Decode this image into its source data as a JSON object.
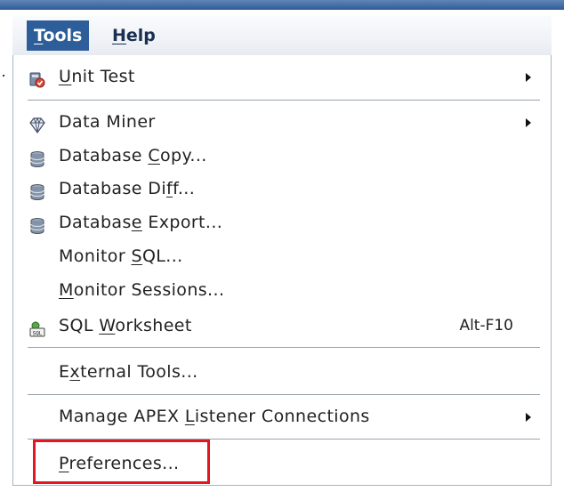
{
  "menubar": {
    "items": [
      {
        "pre": "",
        "key": "T",
        "post": "ools",
        "active": true
      },
      {
        "pre": "",
        "key": "H",
        "post": "elp",
        "active": false
      }
    ]
  },
  "menu": {
    "items": [
      {
        "pre": "",
        "key": "U",
        "post": "nit Test",
        "icon": "unit-test-icon",
        "submenu": true
      },
      {
        "pre": "Data Miner",
        "key": "",
        "post": "",
        "icon": "data-miner-icon",
        "submenu": true
      },
      {
        "pre": "Database ",
        "key": "C",
        "post": "opy...",
        "icon": "database-icon"
      },
      {
        "pre": "Database Di",
        "key": "f",
        "post": "f...",
        "icon": "database-icon"
      },
      {
        "pre": "Databas",
        "key": "e",
        "post": " Export...",
        "icon": "database-icon"
      },
      {
        "pre": "Monitor ",
        "key": "S",
        "post": "QL...",
        "icon": ""
      },
      {
        "pre": "",
        "key": "M",
        "post": "onitor Sessions...",
        "icon": ""
      },
      {
        "pre": "SQL ",
        "key": "W",
        "post": "orksheet",
        "icon": "sql-worksheet-icon",
        "shortcut": "Alt-F10"
      },
      {
        "pre": "E",
        "key": "x",
        "post": "ternal Tools...",
        "icon": ""
      },
      {
        "pre": "Manage APEX ",
        "key": "L",
        "post": "istener Connections",
        "icon": "",
        "submenu": true
      },
      {
        "pre": "",
        "key": "P",
        "post": "references...",
        "icon": ""
      }
    ]
  },
  "colors": {
    "accent": "#2e5e9a",
    "highlight": "#e3171f"
  }
}
